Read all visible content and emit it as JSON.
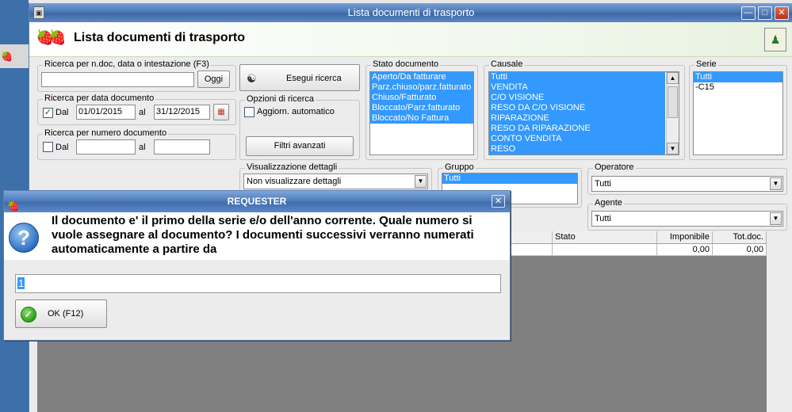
{
  "window": {
    "title": "Lista documenti di trasporto",
    "header_title": "Lista documenti di trasporto"
  },
  "search_doc": {
    "label": "Ricerca per n.doc, data o intestazione (F3)",
    "value": "",
    "today_button": "Oggi"
  },
  "search_button": "Esegui ricerca",
  "search_date": {
    "label": "Ricerca per data documento",
    "checked": true,
    "from_label": "Dal",
    "from_value": "01/01/2015",
    "to_label": "al",
    "to_value": "31/12/2015"
  },
  "search_number": {
    "label": "Ricerca per numero documento",
    "checked": false,
    "from_label": "Dal",
    "from_value": "",
    "to_label": "al",
    "to_value": ""
  },
  "search_options": {
    "label": "Opzioni di ricerca",
    "auto_update_label": "Aggiorn. automatico",
    "auto_update_checked": false,
    "advanced_filters_button": "Filtri avanzati"
  },
  "stato_documento": {
    "label": "Stato documento",
    "items": [
      "Aperto/Da fatturare",
      "Parz.chiuso/parz.fatturato",
      "Chiuso/Fatturato",
      "Bloccato/Parz.fatturato",
      "Bloccato/No Fattura"
    ]
  },
  "causale": {
    "label": "Causale",
    "items": [
      "Tutti",
      "VENDITA",
      "C/O VISIONE",
      "RESO DA C/O VISIONE",
      "RIPARAZIONE",
      "RESO DA RIPARAZIONE",
      "CONTO VENDITA",
      "RESO"
    ]
  },
  "serie": {
    "label": "Serie",
    "items": [
      "Tutti",
      "-C15"
    ]
  },
  "visualizzazione": {
    "label": "Visualizzazione dettagli",
    "value": "Non visualizzare dettagli"
  },
  "gruppo": {
    "label": "Gruppo",
    "items": [
      "Tutti"
    ]
  },
  "operatore": {
    "label": "Operatore",
    "value": "Tutti"
  },
  "agente": {
    "label": "Agente",
    "value": "Tutti"
  },
  "grid": {
    "columns": [
      "Stato",
      "Imponibile",
      "Tot.doc."
    ],
    "row": {
      "stato": "",
      "imponibile": "0,00",
      "totdoc": "0,00"
    }
  },
  "dialog": {
    "title": "REQUESTER",
    "message": "Il documento e' il primo della serie e/o dell'anno corrente. Quale numero si vuole assegnare al documento? I documenti successivi verranno numerati automaticamente a partire da",
    "input_value": "1",
    "ok_button": "OK (F12)"
  }
}
